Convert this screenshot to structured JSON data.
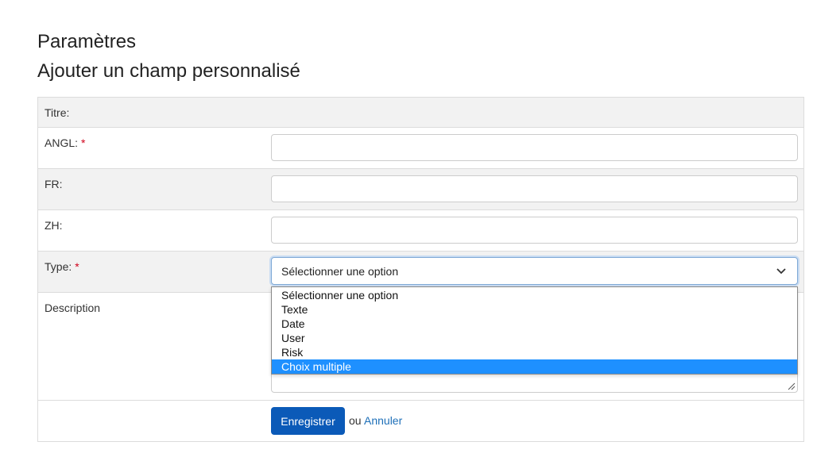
{
  "header": {
    "title": "Paramètres",
    "subtitle": "Ajouter un champ personnalisé"
  },
  "form": {
    "title_label": "Titre:",
    "angl_label": "ANGL:",
    "fr_label": "FR:",
    "zh_label": "ZH:",
    "type_label": "Type:",
    "description_label": "Description",
    "required_marker": "*",
    "type_value": "Sélectionner une option",
    "angl_value": "",
    "fr_value": "",
    "zh_value": ""
  },
  "dropdown": {
    "options": [
      "Sélectionner une option",
      "Texte",
      "Date",
      "User",
      "Risk",
      "Choix multiple"
    ],
    "highlighted": "Choix multiple"
  },
  "actions": {
    "save_label": "Enregistrer",
    "or_text": "ou",
    "cancel_label": "Annuler"
  },
  "colors": {
    "primary": "#0b5ab8",
    "link": "#1d6fb8",
    "required": "#d0021b",
    "highlight": "#1e90ff"
  }
}
